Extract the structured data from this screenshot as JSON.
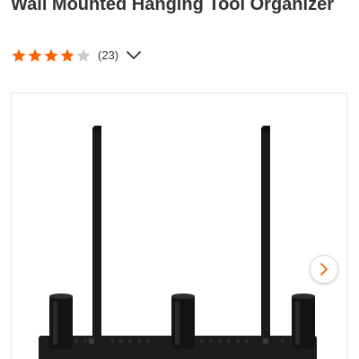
{
  "product": {
    "title": "Wall Mounted Hanging Tool Organizer"
  },
  "rating": {
    "value": 4,
    "max": 5,
    "review_count": "(23)",
    "star_color": "#f96302",
    "empty_star_color": "#cccccc",
    "expand_icon": "chevron-down-icon"
  },
  "gallery": {
    "image_icon": "wall-mounted-tool-organizer-image",
    "next_icon": "chevron-right-icon",
    "accent_color": "#f96302"
  }
}
